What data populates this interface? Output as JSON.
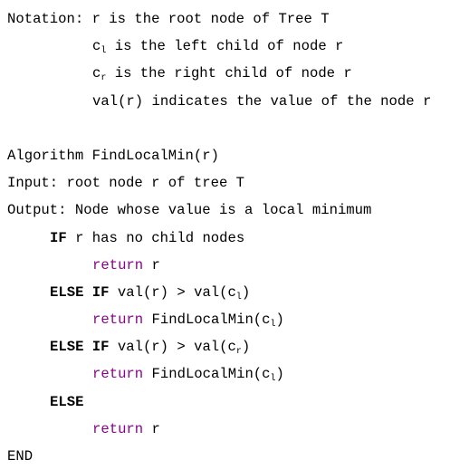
{
  "colors": {
    "keyword_return": "#8b008b"
  },
  "lines": [
    {
      "indent": 0,
      "segs": [
        {
          "t": "Notation: r is the root node of Tree T",
          "s": ""
        }
      ]
    },
    {
      "indent": 10,
      "segs": [
        {
          "t": "c",
          "s": ""
        },
        {
          "t": "l",
          "s": "sub"
        },
        {
          "t": " is the left child of node r",
          "s": ""
        }
      ]
    },
    {
      "indent": 10,
      "segs": [
        {
          "t": "c",
          "s": ""
        },
        {
          "t": "r",
          "s": "sub"
        },
        {
          "t": " is the right child of node r",
          "s": ""
        }
      ]
    },
    {
      "indent": 10,
      "segs": [
        {
          "t": "val(r) indicates the value of the node r",
          "s": ""
        }
      ]
    },
    {
      "indent": 0,
      "segs": []
    },
    {
      "indent": 0,
      "segs": [
        {
          "t": "Algorithm FindLocalMin(r)",
          "s": ""
        }
      ]
    },
    {
      "indent": 0,
      "segs": [
        {
          "t": "Input: root node r of tree T",
          "s": ""
        }
      ]
    },
    {
      "indent": 0,
      "segs": [
        {
          "t": "Output: Node whose value is a local minimum",
          "s": ""
        }
      ]
    },
    {
      "indent": 5,
      "segs": [
        {
          "t": "IF",
          "s": "kw"
        },
        {
          "t": " r has no child nodes",
          "s": ""
        }
      ]
    },
    {
      "indent": 10,
      "segs": [
        {
          "t": "return",
          "s": "ret"
        },
        {
          "t": " r",
          "s": ""
        }
      ]
    },
    {
      "indent": 5,
      "segs": [
        {
          "t": "ELSE IF",
          "s": "kw"
        },
        {
          "t": " val(r) > val(c",
          "s": ""
        },
        {
          "t": "l",
          "s": "sub"
        },
        {
          "t": ")",
          "s": ""
        }
      ]
    },
    {
      "indent": 10,
      "segs": [
        {
          "t": "return",
          "s": "ret"
        },
        {
          "t": " FindLocalMin(c",
          "s": ""
        },
        {
          "t": "l",
          "s": "sub"
        },
        {
          "t": ")",
          "s": ""
        }
      ]
    },
    {
      "indent": 5,
      "segs": [
        {
          "t": "ELSE IF",
          "s": "kw"
        },
        {
          "t": " val(r) > val(c",
          "s": ""
        },
        {
          "t": "r",
          "s": "sub"
        },
        {
          "t": ")",
          "s": ""
        }
      ]
    },
    {
      "indent": 10,
      "segs": [
        {
          "t": "return",
          "s": "ret"
        },
        {
          "t": " FindLocalMin(c",
          "s": ""
        },
        {
          "t": "l",
          "s": "sub"
        },
        {
          "t": ")",
          "s": ""
        }
      ]
    },
    {
      "indent": 5,
      "segs": [
        {
          "t": "ELSE",
          "s": "kw"
        }
      ]
    },
    {
      "indent": 10,
      "segs": [
        {
          "t": "return",
          "s": "ret"
        },
        {
          "t": " r",
          "s": ""
        }
      ]
    },
    {
      "indent": 0,
      "segs": [
        {
          "t": "END",
          "s": ""
        }
      ]
    }
  ]
}
